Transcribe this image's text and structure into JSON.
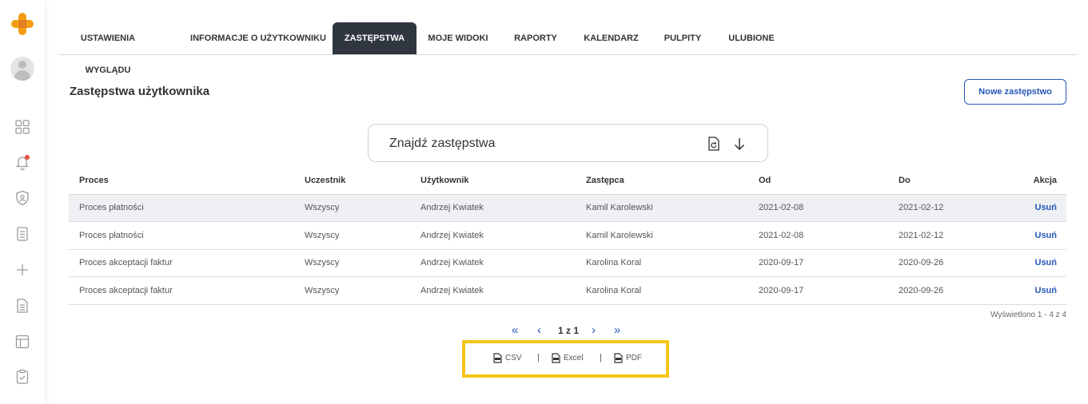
{
  "colors": {
    "accent": "#2557b8",
    "active_tab": "#2f3640",
    "logo": "#f39c12",
    "highlight": "#f5c518",
    "notification": "#e74c3c"
  },
  "sidebar": {
    "icons": [
      "logo-icon",
      "avatar",
      "dashboard-icon",
      "notification-bell-icon",
      "security-shield-icon",
      "checklist-icon",
      "add-icon",
      "document-icon",
      "layout-icon",
      "tasks-clipboard-icon"
    ]
  },
  "tabs": [
    {
      "label": "USTAWIENIA WYGLĄDU",
      "active": false
    },
    {
      "label": "INFORMACJE O UŻYTKOWNIKU",
      "active": false
    },
    {
      "label": "ZASTĘPSTWA",
      "active": true
    },
    {
      "label": "MOJE WIDOKI",
      "active": false
    },
    {
      "label": "RAPORTY",
      "active": false
    },
    {
      "label": "KALENDARZ",
      "active": false
    },
    {
      "label": "PULPITY",
      "active": false
    },
    {
      "label": "ULUBIONE",
      "active": false
    }
  ],
  "page": {
    "title": "Zastępstwa użytkownika",
    "new_button": "Nowe zastępstwo",
    "search_label": "Znajdź zastępstwa"
  },
  "table": {
    "headers": {
      "process": "Proces",
      "participant": "Uczestnik",
      "user": "Użytkownik",
      "substitute": "Zastępca",
      "from": "Od",
      "to": "Do",
      "action": "Akcja"
    },
    "rows": [
      {
        "process": "Proces płatności",
        "participant": "Wszyscy",
        "user": "Andrzej Kwiatek",
        "substitute": "Kamil Karolewski",
        "from": "2021-02-08",
        "to": "2021-02-12",
        "action": "Usuń"
      },
      {
        "process": "Proces płatności",
        "participant": "Wszyscy",
        "user": "Andrzej Kwiatek",
        "substitute": "Kamil Karolewski",
        "from": "2021-02-08",
        "to": "2021-02-12",
        "action": "Usuń"
      },
      {
        "process": "Proces akceptacji faktur",
        "participant": "Wszyscy",
        "user": "Andrzej Kwiatek",
        "substitute": "Karolina Koral",
        "from": "2020-09-17",
        "to": "2020-09-26",
        "action": "Usuń"
      },
      {
        "process": "Proces akceptacji faktur",
        "participant": "Wszyscy",
        "user": "Andrzej Kwiatek",
        "substitute": "Karolina Koral",
        "from": "2020-09-17",
        "to": "2020-09-26",
        "action": "Usuń"
      }
    ],
    "count_text": "Wyświetlono 1 - 4 z 4"
  },
  "pager": {
    "first": "«",
    "prev": "‹",
    "info": "1 z 1",
    "next": "›",
    "last": "»"
  },
  "export": {
    "csv": "CSV",
    "excel": "Excel",
    "pdf": "PDF",
    "separator": "|"
  }
}
